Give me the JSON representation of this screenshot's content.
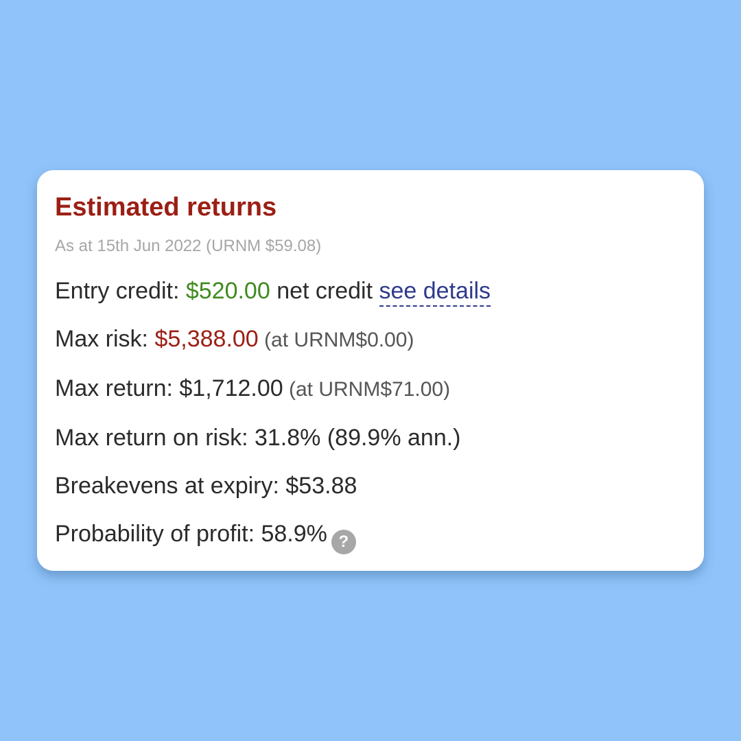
{
  "card": {
    "title": "Estimated returns",
    "subtitle": "As at 15th Jun 2022 (URNM $59.08)"
  },
  "entry_credit": {
    "label": "Entry credit: ",
    "value": "$520.00",
    "suffix": " net credit ",
    "link": "see details"
  },
  "max_risk": {
    "label": "Max risk: ",
    "value": "$5,388.00",
    "note": " (at URNM$0.00)"
  },
  "max_return": {
    "label": "Max return: ",
    "value": "$1,712.00",
    "note": " (at URNM$71.00)"
  },
  "max_return_on_risk": {
    "label": "Max return on risk: ",
    "value": "31.8% (89.9% ann.)"
  },
  "breakevens": {
    "label": "Breakevens at expiry: ",
    "value": "$53.88"
  },
  "probability": {
    "label": "Probability of profit: ",
    "value": "58.9%",
    "help_glyph": "?"
  },
  "colors": {
    "background": "#8fc3f9",
    "title": "#9b1f14",
    "positive": "#3f8a1f",
    "negative": "#9b1f14",
    "link": "#2e3a8c"
  },
  "icons": {
    "help": "question-circle-icon"
  }
}
